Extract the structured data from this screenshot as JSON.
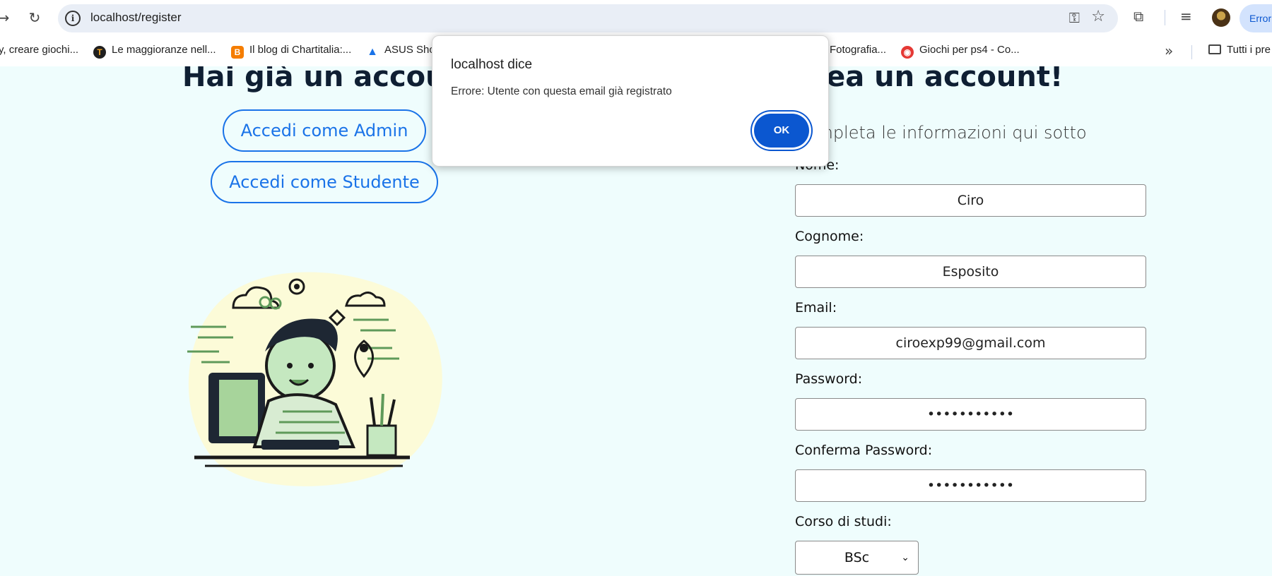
{
  "browser": {
    "url": "localhost/register",
    "profile_button_label": "Errori",
    "bookmarks": [
      {
        "label": "y, creare giochi...",
        "icon": "none"
      },
      {
        "label": "Le maggioranze nell...",
        "icon": "site-favicon-icon"
      },
      {
        "label": "Il blog di Chartitalia:...",
        "icon": "blogger-icon"
      },
      {
        "label": "ASUS Sho",
        "icon": "asus-icon"
      },
      {
        "label": "Fotografia...",
        "icon": "none"
      },
      {
        "label": "Giochi per ps4 - Co...",
        "icon": "site-favicon-icon"
      }
    ],
    "bookmarks_folder": "Tutti i pre"
  },
  "page": {
    "login_heading": "Hai già un account?",
    "register_heading": "Crea un account!",
    "admin_button": "Accedi come Admin",
    "student_button": "Accedi come Studente",
    "register_subtitle": "Completa le informazioni qui sotto",
    "form": {
      "nome_label": "Nome:",
      "nome_value": "Ciro",
      "cognome_label": "Cognome:",
      "cognome_value": "Esposito",
      "email_label": "Email:",
      "email_value": "ciroexp99@gmail.com",
      "password_label": "Password:",
      "password_value": "•••••••••••",
      "confirm_label": "Conferma Password:",
      "confirm_value": "•••••••••••",
      "corso_label": "Corso di studi:",
      "corso_value": "BSc"
    }
  },
  "dialog": {
    "title": "localhost dice",
    "message": "Errore: Utente con questa email già registrato",
    "ok_label": "OK"
  },
  "colors": {
    "page_bg": "#effdfd",
    "accent": "#1a73e8",
    "dialog_button": "#0b57d0",
    "heading": "#0f1f33"
  }
}
